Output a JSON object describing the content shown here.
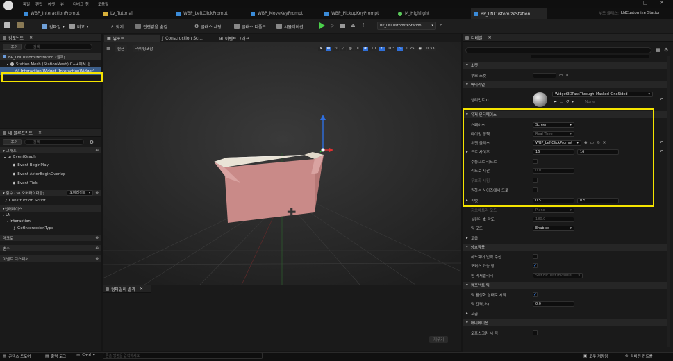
{
  "menu": [
    "파일",
    "편집",
    "에셋",
    "뷰",
    "디버그",
    "창",
    "도움말"
  ],
  "tabs": [
    {
      "label": "WBP_InteractionPrompt",
      "color": "#3a8bd8"
    },
    {
      "label": "LV_Tutorial",
      "color": "#d8b03a"
    },
    {
      "label": "WBP_LeftClickPrompt",
      "color": "#3a8bd8"
    },
    {
      "label": "WBP_MoveKeyPrompt",
      "color": "#3a8bd8"
    },
    {
      "label": "WBP_PickupKeyPrompt",
      "color": "#3a8bd8"
    },
    {
      "label": "M_Highlight",
      "color": "#5bc85b"
    },
    {
      "label": "BP_LNCustomizeStation",
      "color": "#3a8bd8"
    }
  ],
  "parent_class": {
    "label": "부모 클래스:",
    "value": "LNCustomize Station"
  },
  "toolbar": {
    "compile": "컴파일",
    "diff": "비교",
    "find": "찾기",
    "hide_unrelated": "관련없음 숨김",
    "class_settings": "클래스 세팅",
    "class_defaults": "클래스 디폴트",
    "simulation": "시뮬레이션",
    "debug_target": "BP_LNCustomizeStation"
  },
  "components": {
    "title": "컴포넌트",
    "add": "추가",
    "search_placeholder": "검색",
    "items": [
      {
        "label": "BP_LNCustomizeStation (셀프)"
      },
      {
        "label": "Station Mesh (StationMesh)  C++에서 편"
      },
      {
        "label": "Interaction Widget (InteractionWidget)"
      }
    ]
  },
  "my_blueprint": {
    "title": "내 블루프린트",
    "add": "추가",
    "search_placeholder": "검색",
    "graphs_header": "그래프",
    "event_graph": "EventGraph",
    "events": [
      "Event BeginPlay",
      "Event ActorBeginOverlap",
      "Event Tick"
    ],
    "functions_header": "함수 (38 오버라이더블)",
    "override_label": "오버라이드",
    "construction": "Construction Script",
    "interfaces_header": "인터페이스",
    "ln": "LN",
    "interaction": "Interaction",
    "get_type": "GetInteractionType",
    "macros": "매크로",
    "variables": "변수",
    "dispatchers": "이벤트 디스패처"
  },
  "viewport": {
    "tabs": [
      "뷰포트",
      "Construction Scr...",
      "이벤트 그래프"
    ],
    "perspective": "원근",
    "lighting": "라이팅포함",
    "grid": "10",
    "angle": "10°",
    "scale": "0.25",
    "speed": "0.33"
  },
  "compile_results": {
    "title": "컴파일러 결과",
    "clear": "지우기"
  },
  "details": {
    "title": "디테일",
    "sections": {
      "rendering": "소켓",
      "material_sec": "머티리얼",
      "user_interface": "유저 인터페이스",
      "advanced": "고급",
      "interaction": "상호작용",
      "component_tick": "컴포넌트 틱",
      "advanced2": "고급",
      "animation": "애니메이션"
    },
    "parent_socket": "부모 소켓",
    "material_label": "엘리먼트 0",
    "material_value": "Widget3DPassThrough_Masked_OneSided",
    "material_sub": "None",
    "ui": [
      {
        "label": "스페이스",
        "value": "Screen"
      },
      {
        "label": "타이밍 정책",
        "value": "Real Time"
      },
      {
        "label": "위젯 클래스",
        "value": "WBP_LeftClickPrompt"
      },
      {
        "label": "드로 사이즈",
        "value": "16",
        "value2": "16"
      },
      {
        "label": "수동으로 리드로",
        "value": ""
      },
      {
        "label": "리드로 시간",
        "value": "0.0"
      },
      {
        "label": "무효화 시킴",
        "value": ""
      },
      {
        "label": "원하는 사이즈에서 드로",
        "value": ""
      },
      {
        "label": "피벗",
        "value": "0.5",
        "value2": "0.5"
      }
    ],
    "after_ui": [
      {
        "label": "지오메트리 모드",
        "value": "Plane"
      },
      {
        "label": "실린더 호 각도",
        "value": "180.0"
      },
      {
        "label": "틱 모드",
        "value": "Enabled"
      }
    ],
    "interaction_rows": [
      {
        "label": "하드웨어 입력 수신",
        "value": ""
      },
      {
        "label": "포커스 가능 창",
        "value": "✓"
      },
      {
        "label": "윈 비저빌리티",
        "value": "Self Hit Test Invisible"
      }
    ],
    "tick_rows": [
      {
        "label": "틱 활성화 상태로 시작",
        "value": "✓"
      },
      {
        "label": "틱 간격(초)",
        "value": "0.0"
      }
    ],
    "anim_rows": [
      {
        "label": "오프스크린 시 틱",
        "value": ""
      }
    ]
  },
  "bottom": {
    "content_drawer": "콘텐츠 드로어",
    "output_log": "출력 로그",
    "cmd": "Cmd",
    "console_placeholder": "콘솔 명령을 입력하세요",
    "save_all": "모두 저장됨",
    "revision": "리비전 컨트롤"
  }
}
